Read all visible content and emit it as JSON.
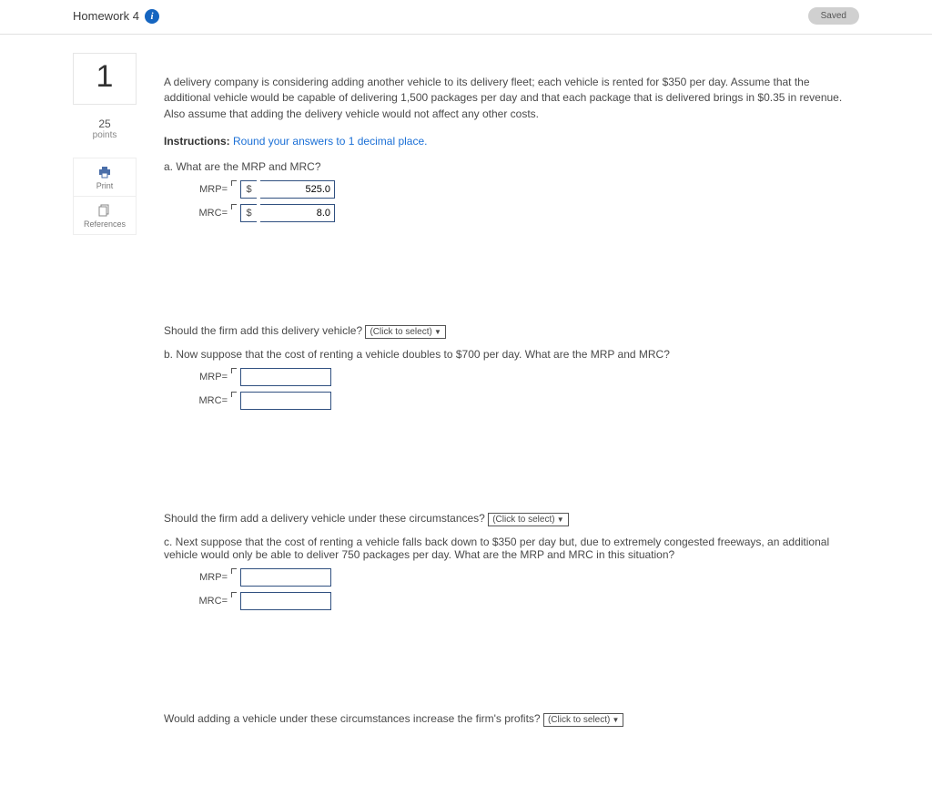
{
  "header": {
    "title": "Homework 4",
    "saved_label": "Saved"
  },
  "side": {
    "question_number": "1",
    "points_value": "25",
    "points_label": "points",
    "print_label": "Print",
    "references_label": "References"
  },
  "content": {
    "intro": "A delivery company is considering adding another vehicle to its delivery fleet; each vehicle is rented for $350 per day. Assume that the additional vehicle would be capable of delivering 1,500 packages per day and that each package that is delivered brings in $0.35 in revenue. Also assume that adding the delivery vehicle would not affect any other costs.",
    "instructions_label": "Instructions:",
    "instructions_text": "Round your answers to 1 decimal place.",
    "a": {
      "prompt": "a. What are the MRP and MRC?",
      "mrp_label": "MRP=",
      "mrp_currency": "$",
      "mrp_value": "525.0",
      "mrc_label": "MRC=",
      "mrc_currency": "$",
      "mrc_value": "8.0",
      "follow": "Should the firm add this delivery vehicle?",
      "select": "(Click to select)"
    },
    "b": {
      "prompt": "b. Now suppose that the cost of renting a vehicle doubles to $700 per day. What are the MRP and MRC?",
      "mrp_label": "MRP=",
      "mrc_label": "MRC=",
      "follow": "Should the firm add a delivery vehicle under these circumstances?",
      "select": "(Click to select)"
    },
    "c": {
      "prompt": "c. Next suppose that the cost of renting a vehicle falls back down to $350 per day but, due to extremely congested freeways, an additional vehicle would only be able to deliver 750 packages per day. What are the MRP and MRC in this situation?",
      "mrp_label": "MRP=",
      "mrc_label": "MRC=",
      "follow": "Would adding a vehicle under these circumstances increase the firm's profits?",
      "select": "(Click to select)"
    }
  }
}
